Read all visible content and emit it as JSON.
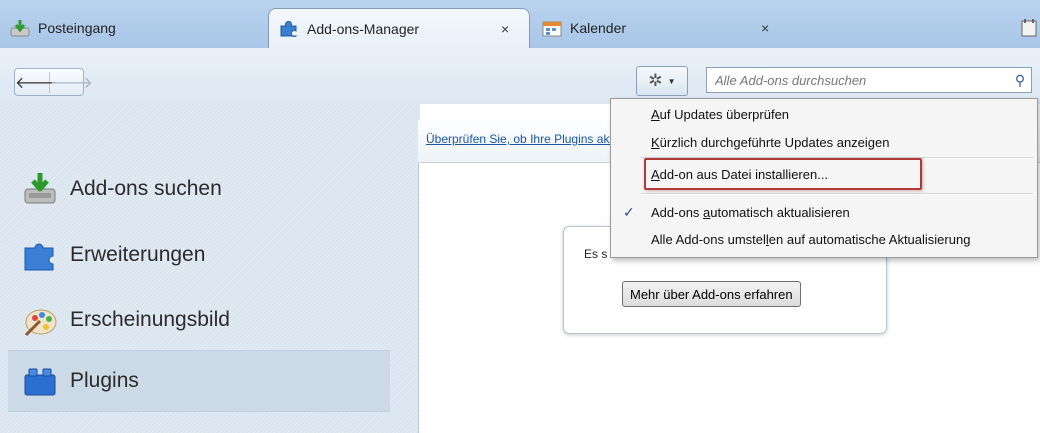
{
  "tabs": [
    {
      "label": "Posteingang",
      "icon": "inbox-download-icon"
    },
    {
      "label": "Add-ons-Manager",
      "icon": "puzzle-piece-icon",
      "close": "×"
    },
    {
      "label": "Kalender",
      "icon": "calendar-icon",
      "close": "×"
    }
  ],
  "toolbar": {
    "back": "🡐",
    "forward": "🡒",
    "tools_icon": "gear-icon",
    "search_placeholder": "Alle Add-ons durchsuchen"
  },
  "sidebar": {
    "items": [
      {
        "label": "Add-ons suchen",
        "icon": "download-tray-icon"
      },
      {
        "label": "Erweiterungen",
        "icon": "puzzle-piece-icon"
      },
      {
        "label": "Erscheinungsbild",
        "icon": "paint-palette-icon"
      },
      {
        "label": "Plugins",
        "icon": "plugin-blocks-icon",
        "selected": true
      }
    ]
  },
  "content": {
    "notice_link": "Überprüfen Sie, ob Ihre Plugins aktuell sind",
    "info_text": "Es s",
    "learn_more_button": "Mehr über Add-ons erfahren"
  },
  "menu": {
    "items": [
      {
        "label": "Auf Updates überprüfen",
        "mnemonic_index": 0
      },
      {
        "label": "Kürzlich durchgeführte Updates anzeigen",
        "mnemonic_index": 0
      },
      {
        "label": "Add-on aus Datei installieren...",
        "mnemonic_index": 0,
        "highlighted": true
      },
      {
        "label": "Add-ons automatisch aktualisieren",
        "mnemonic_index": 8,
        "checked": true
      },
      {
        "label": "Alle Add-ons umstellen auf automatische Aktualisierung",
        "mnemonic_index": 19
      }
    ],
    "check_mark": "✓"
  },
  "colors": {
    "tabbar": "#b9d3ee",
    "sidebar": "#dfe8f2",
    "link": "#1a55a8",
    "highlight_box": "#b03a3a"
  }
}
